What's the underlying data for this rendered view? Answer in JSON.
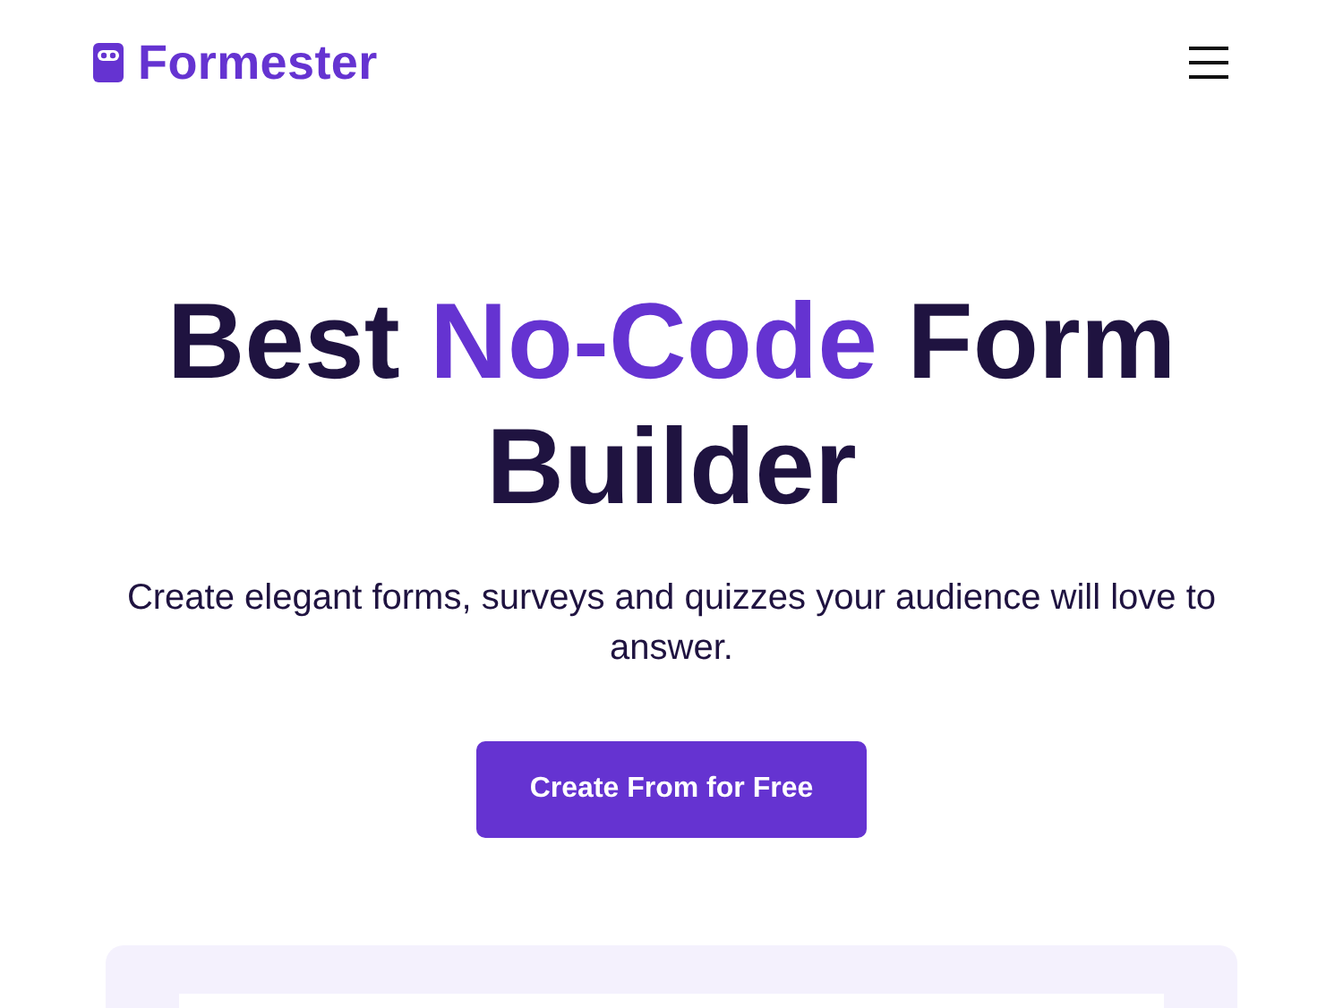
{
  "header": {
    "logo": "Formester"
  },
  "hero": {
    "title": [
      {
        "text": "Best ",
        "highlight": false
      },
      {
        "text": "No-Code",
        "highlight": true
      },
      {
        "text": " Form Builder",
        "highlight": false
      }
    ],
    "subtitle": "Create elegant forms, surveys and quizzes your audience will love to answer.",
    "cta": "Create From for Free"
  }
}
